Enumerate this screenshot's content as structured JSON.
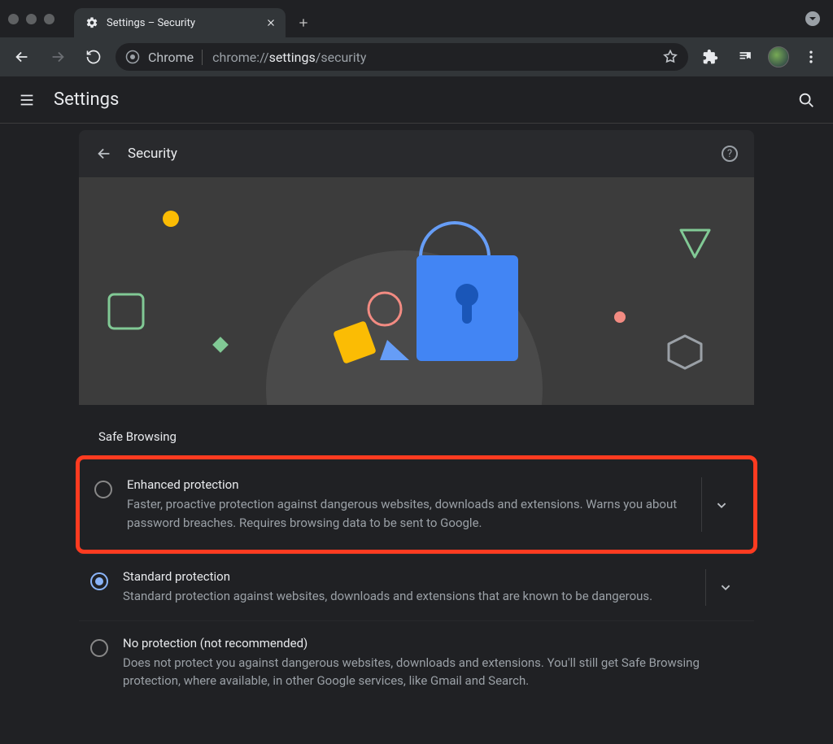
{
  "window": {
    "tab_title": "Settings – Security"
  },
  "toolbar": {
    "site_chip": "Chrome",
    "url_prefix": "chrome://",
    "url_highlight": "settings",
    "url_suffix": "/security"
  },
  "appbar": {
    "title": "Settings"
  },
  "page": {
    "section_title": "Security",
    "group_label": "Safe Browsing",
    "options": [
      {
        "title": "Enhanced protection",
        "description": "Faster, proactive protection against dangerous websites, downloads and extensions. Warns you about password breaches. Requires browsing data to be sent to Google.",
        "selected": false,
        "expandable": true,
        "highlighted": true
      },
      {
        "title": "Standard protection",
        "description": "Standard protection against websites, downloads and extensions that are known to be dangerous.",
        "selected": true,
        "expandable": true,
        "highlighted": false
      },
      {
        "title": "No protection (not recommended)",
        "description": "Does not protect you against dangerous websites, downloads and extensions. You'll still get Safe Browsing protection, where available, in other Google services, like Gmail and Search.",
        "selected": false,
        "expandable": false,
        "highlighted": false
      }
    ]
  }
}
